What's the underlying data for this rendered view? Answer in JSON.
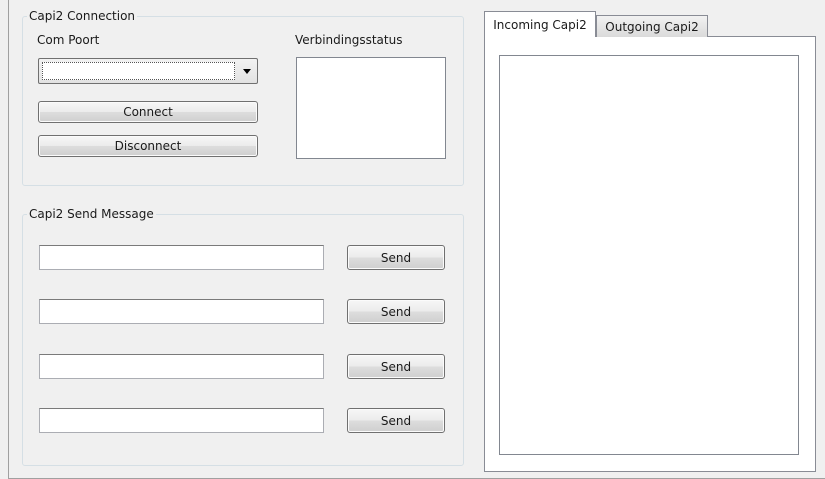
{
  "connection_group": {
    "title": "Capi2 Connection",
    "com_port_label": "Com Poort",
    "com_port_value": "",
    "status_label": "Verbindingsstatus",
    "connect_label": "Connect",
    "disconnect_label": "Disconnect"
  },
  "send_group": {
    "title": "Capi2 Send Message",
    "rows": [
      {
        "value": "",
        "send_label": "Send"
      },
      {
        "value": "",
        "send_label": "Send"
      },
      {
        "value": "",
        "send_label": "Send"
      },
      {
        "value": "",
        "send_label": "Send"
      }
    ]
  },
  "tabs": [
    {
      "label": "Incoming Capi2",
      "active": true
    },
    {
      "label": "Outgoing Capi2",
      "active": false
    }
  ]
}
